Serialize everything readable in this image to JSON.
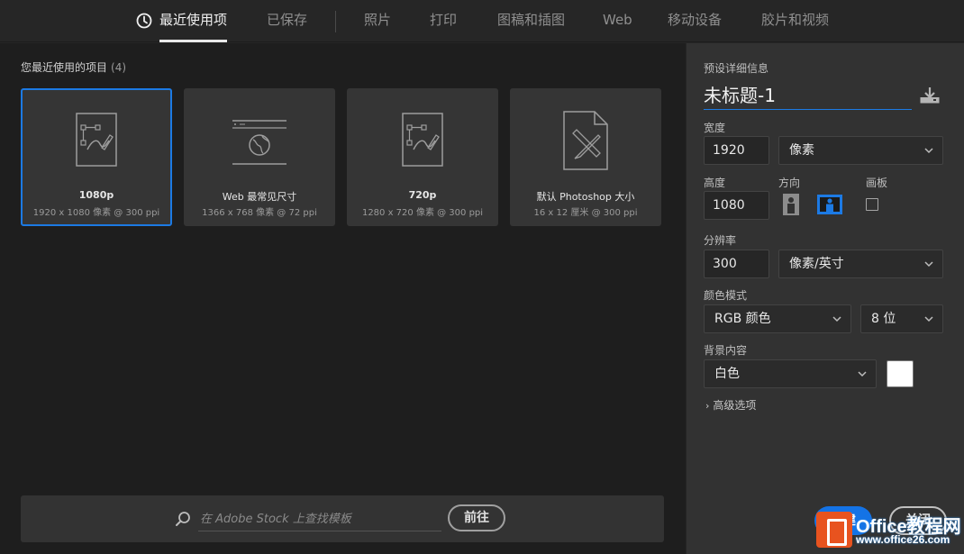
{
  "tabs": [
    {
      "label": "最近使用项",
      "active": true
    },
    {
      "label": "已保存",
      "active": false
    },
    {
      "label": "照片",
      "active": false
    },
    {
      "label": "打印",
      "active": false
    },
    {
      "label": "图稿和插图",
      "active": false
    },
    {
      "label": "Web",
      "active": false
    },
    {
      "label": "移动设备",
      "active": false
    },
    {
      "label": "胶片和视频",
      "active": false
    }
  ],
  "recent": {
    "title": "您最近使用的项目",
    "count": "(4)",
    "items": [
      {
        "name": "1080p",
        "spec": "1920 x 1080 像素 @ 300 ppi",
        "icon": "artboard-icon"
      },
      {
        "name": "Web 最常见尺寸",
        "spec": "1366 x 768 像素 @ 72 ppi",
        "icon": "web-page-icon"
      },
      {
        "name": "720p",
        "spec": "1280 x 720 像素 @ 300 ppi",
        "icon": "artboard-icon"
      },
      {
        "name": "默认 Photoshop 大小",
        "spec": "16 x 12 厘米 @ 300 ppi",
        "icon": "document-tools-icon"
      }
    ]
  },
  "search": {
    "placeholder": "在 Adobe Stock 上查找模板",
    "go_label": "前往"
  },
  "preset": {
    "section_label": "预设详细信息",
    "doc_name": "未标题-1",
    "width_label": "宽度",
    "width_value": "1920",
    "width_unit": "像素",
    "height_label": "高度",
    "height_value": "1080",
    "orientation_label": "方向",
    "artboard_label": "画板",
    "resolution_label": "分辨率",
    "resolution_value": "300",
    "resolution_unit": "像素/英寸",
    "color_mode_label": "颜色模式",
    "color_mode": "RGB 颜色",
    "bit_depth": "8 位",
    "background_label": "背景内容",
    "background": "白色",
    "background_color": "#ffffff",
    "advanced_label": "高级选项",
    "create_label": "创建",
    "close_label": "关闭"
  },
  "watermark": {
    "brand": "Office教程网",
    "url": "www.office26.com"
  },
  "colors": {
    "accent": "#1473e6",
    "selected_border": "#1c7ae4",
    "panel": "#323232",
    "main": "#1e1e1e"
  }
}
